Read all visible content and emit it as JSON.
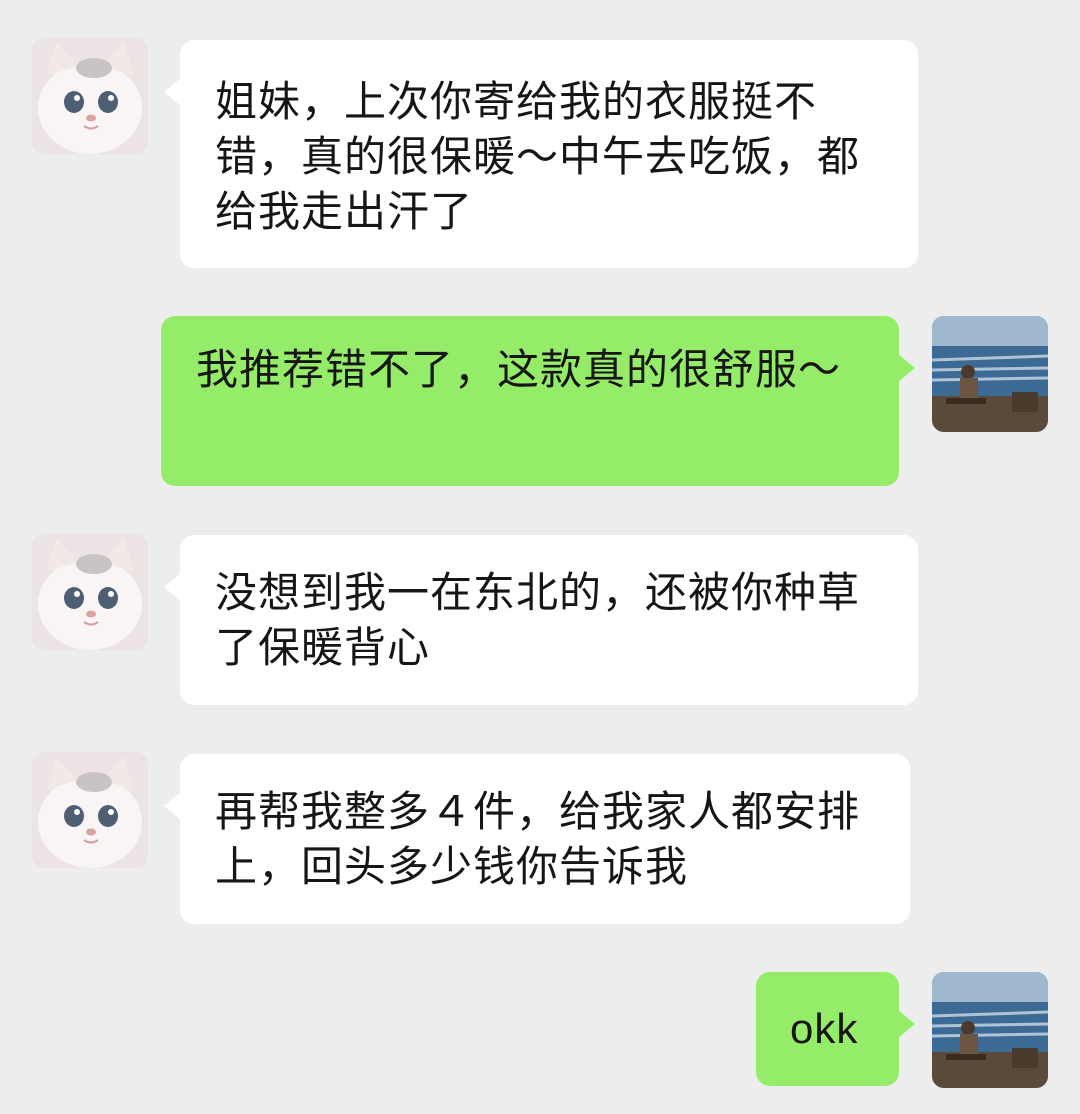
{
  "messages": [
    {
      "side": "received",
      "avatar": "white-cat-avatar",
      "text": "姐妹，上次你寄给我的衣服挺不错，真的很保暖～中午去吃饭，都给我走出汗了"
    },
    {
      "side": "sent",
      "avatar": "seaside-avatar",
      "text": "我推荐错不了，这款真的很舒服～"
    },
    {
      "side": "received",
      "avatar": "white-cat-avatar",
      "text": "没想到我一在东北的，还被你种草了保暖背心"
    },
    {
      "side": "received",
      "avatar": "white-cat-avatar",
      "text": "再帮我整多４件，给我家人都安排上，回头多少钱你告诉我"
    },
    {
      "side": "sent",
      "avatar": "seaside-avatar",
      "text": "okk"
    }
  ],
  "colors": {
    "background": "#ededed",
    "received_bubble": "#ffffff",
    "sent_bubble": "#95ec69",
    "text": "#161616"
  }
}
